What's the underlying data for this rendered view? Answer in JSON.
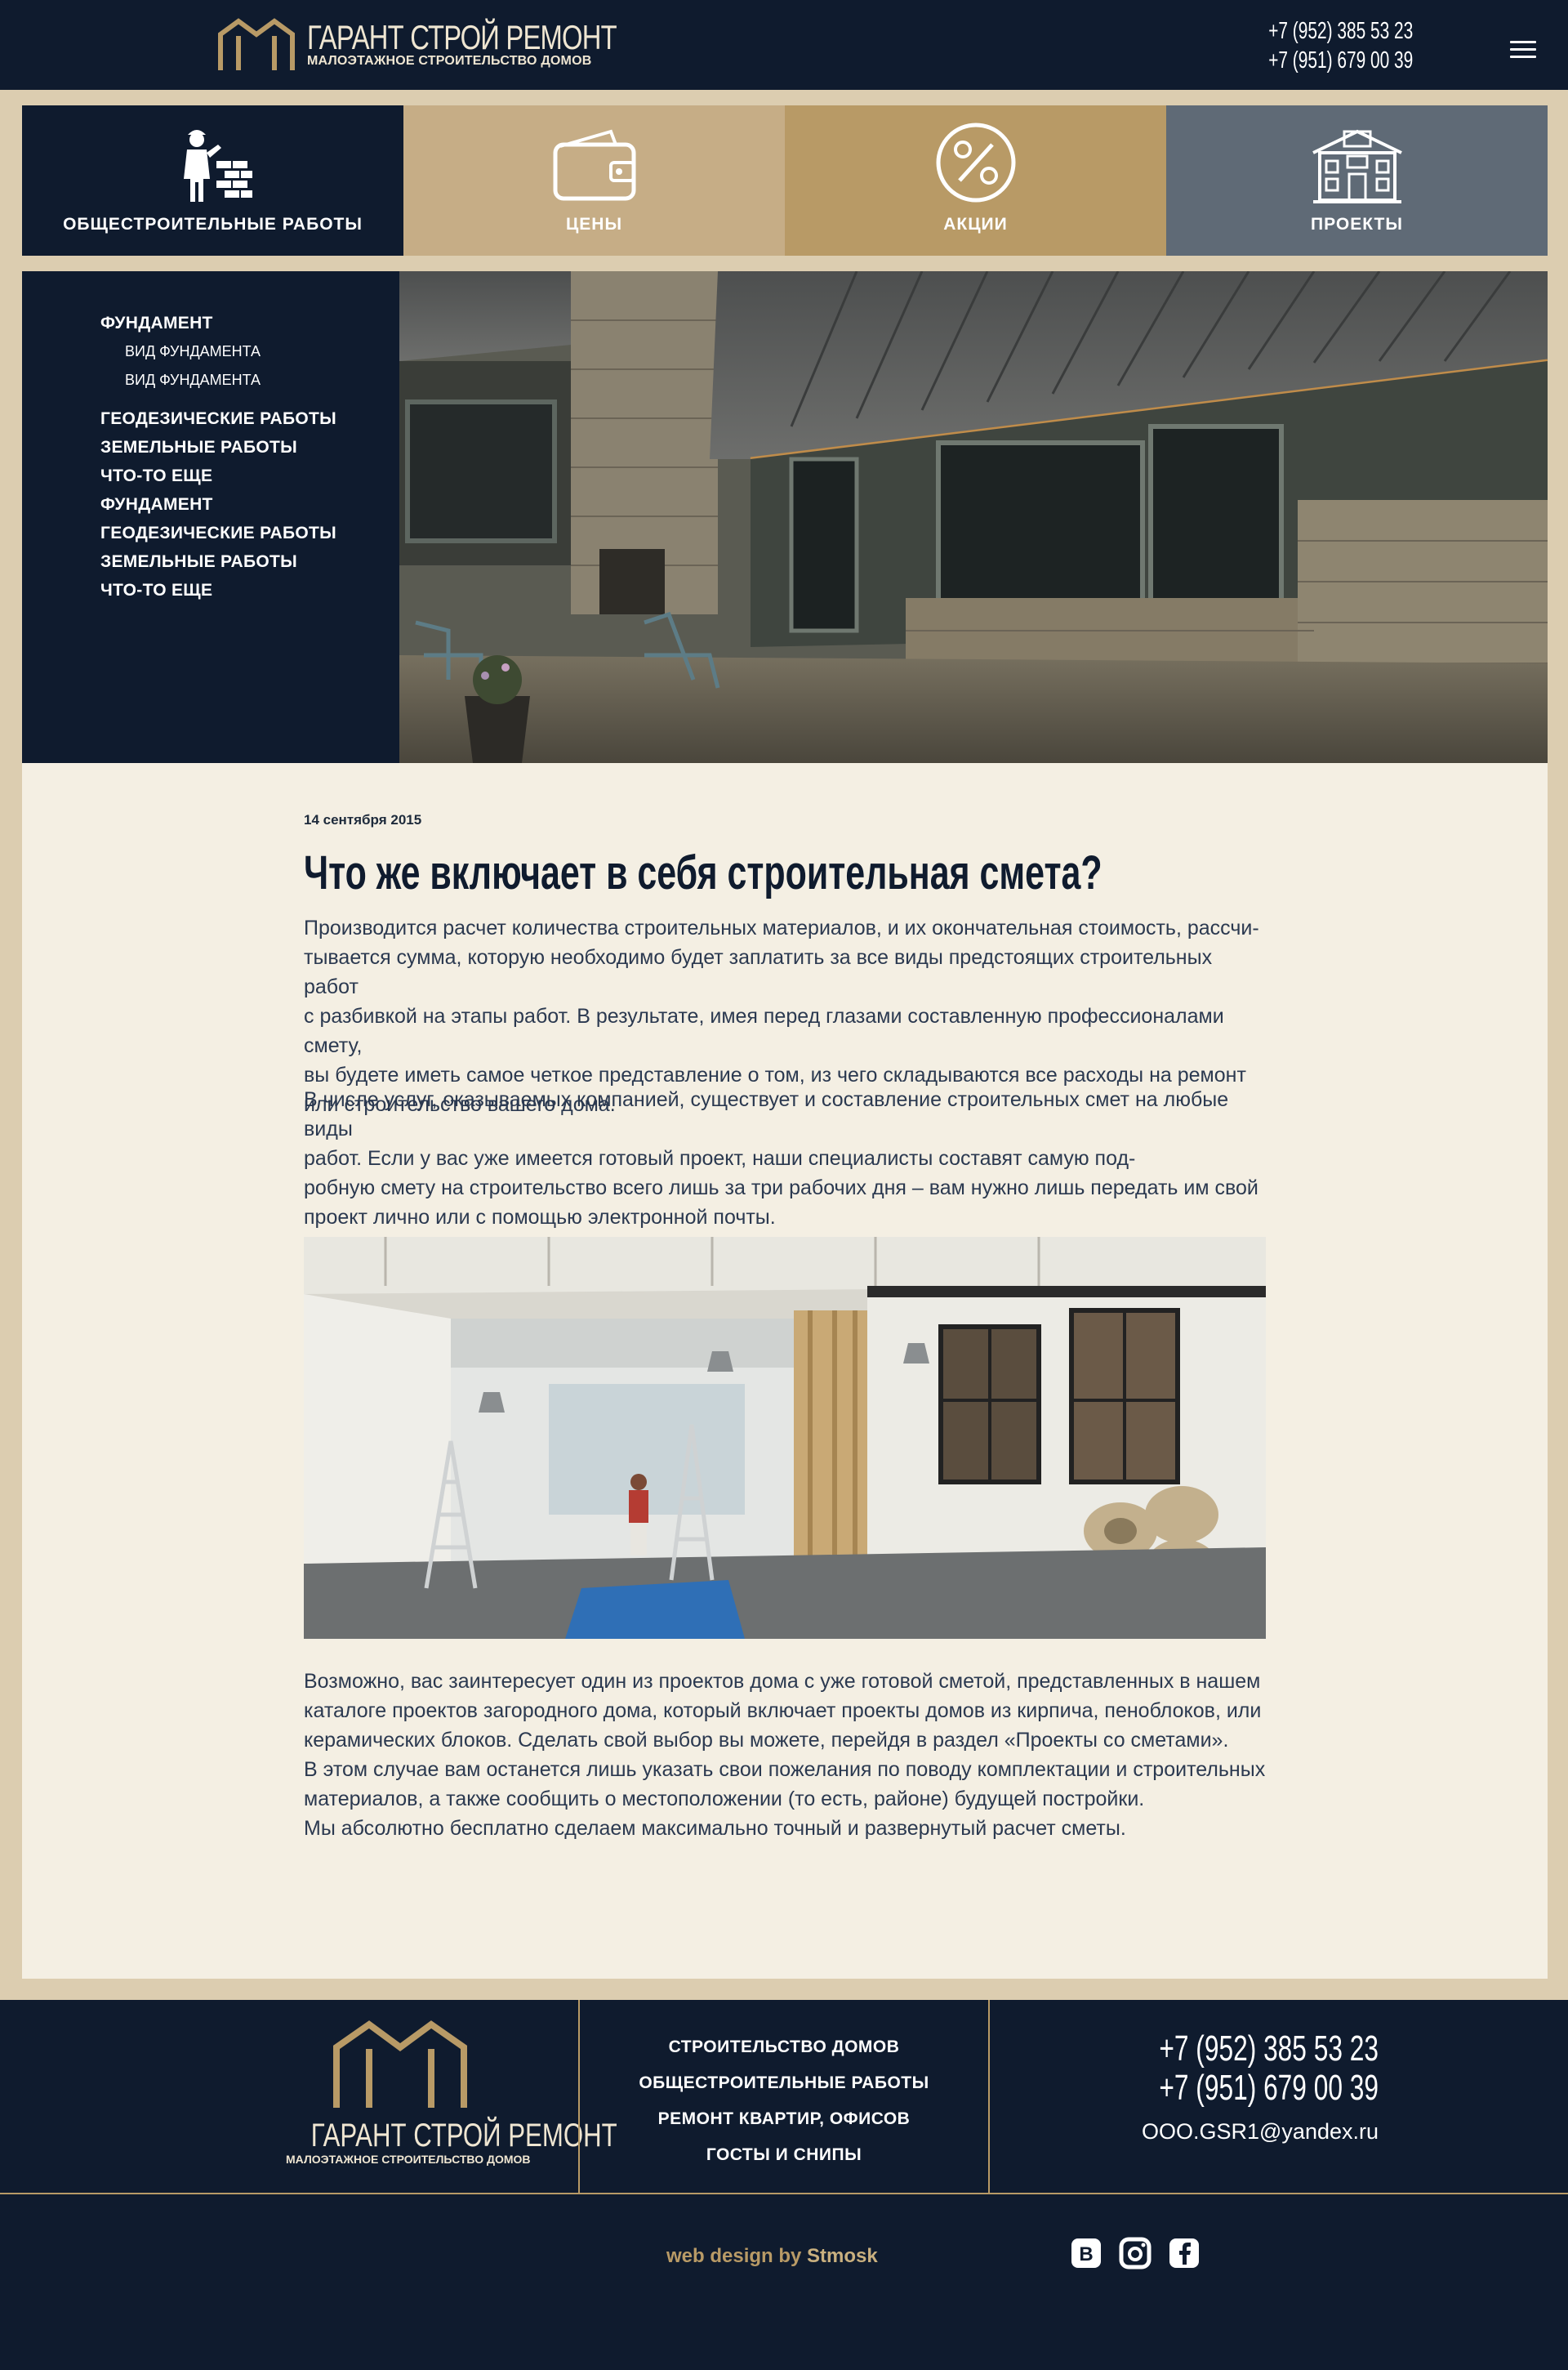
{
  "header": {
    "logo_title": "ГАРАНТ СТРОЙ РЕМОНТ",
    "logo_subtitle": "МАЛОЭТАЖНОЕ СТРОИТЕЛЬСТВО ДОМОВ",
    "phones": [
      "+7 (952) 385 53 23",
      "+7 (951) 679 00 39"
    ]
  },
  "tiles": [
    {
      "label": "ОБЩЕСТРОИТЕЛЬНЫЕ РАБОТЫ",
      "icon": "builder-icon",
      "color": "#0f1b2e"
    },
    {
      "label": "ЦЕНЫ",
      "icon": "wallet-icon",
      "color": "#c6ad86"
    },
    {
      "label": "АКЦИИ",
      "icon": "percent-icon",
      "color": "#b89a66"
    },
    {
      "label": "ПРОЕКТЫ",
      "icon": "house-icon",
      "color": "#5f6a76"
    }
  ],
  "side_menu": {
    "items": [
      {
        "label": "ФУНДАМЕНТ"
      },
      {
        "label": "ВИД ФУНДАМЕНТА"
      },
      {
        "label": "ВИД ФУНДАМЕНТА"
      },
      {
        "label": "ГЕОДЕЗИЧЕСКИЕ РАБОТЫ"
      },
      {
        "label": "ЗЕМЕЛЬНЫЕ РАБОТЫ"
      },
      {
        "label": "ЧТО-ТО ЕЩЕ"
      },
      {
        "label": "ФУНДАМЕНТ"
      },
      {
        "label": "ГЕОДЕЗИЧЕСКИЕ РАБОТЫ"
      },
      {
        "label": "ЗЕМЕЛЬНЫЕ РАБОТЫ"
      },
      {
        "label": "ЧТО-ТО ЕЩЕ"
      }
    ]
  },
  "article": {
    "date": "14 сентября 2015",
    "title": "Что же включает в себя строительная смета?",
    "paragraph_1": [
      "Производится расчет количества строительных материалов, и их окончательная стоимость, рассчи-",
      "тывается сумма, которую необходимо будет заплатить за все виды предстоящих строительных работ",
      "с разбивкой на этапы работ. В результате, имея перед глазами составленную профессионалами смету,",
      "вы будете иметь самое четкое представление о том, из чего складываются все расходы на ремонт",
      "или строительство вашего дома."
    ],
    "paragraph_2": [
      "В числе услуг, оказываемых компанией, существует и составление строительных смет на любые виды",
      "работ. Если у вас уже имеется готовый проект, наши специалисты составят самую под-",
      "робную смету на строительство всего лишь за три рабочих дня – вам нужно лишь передать им свой",
      "проект лично или с помощью электронной почты."
    ],
    "paragraph_3": [
      "Возможно, вас заинтересует один из проектов дома с уже готовой сметой, представленных в нашем",
      "каталоге проектов загородного дома, который включает проекты домов из кирпича, пеноблоков, или",
      "керамических блоков. Сделать свой выбор вы можете, перейдя в раздел «Проекты со сметами».",
      "В этом случае вам останется лишь указать свои пожелания по поводу комплектации и строительных",
      "материалов, а также сообщить о местоположении (то есть, районе) будущей постройки.",
      "Мы абсолютно бесплатно сделаем максимально точный и развернутый расчет сметы."
    ]
  },
  "footer": {
    "logo_title": "ГАРАНТ СТРОЙ РЕМОНТ",
    "logo_subtitle": "МАЛОЭТАЖНОЕ СТРОИТЕЛЬСТВО ДОМОВ",
    "menu": [
      "СТРОИТЕЛЬСТВО ДОМОВ",
      "ОБЩЕСТРОИТЕЛЬНЫЕ РАБОТЫ",
      "РЕМОНТ КВАРТИР, ОФИСОВ",
      "ГОСТЫ И СНИПЫ"
    ],
    "phones": [
      "+7 (952) 385 53 23",
      "+7 (951) 679 00 39"
    ],
    "email": "OOO.GSR1@yandex.ru",
    "credit_prefix": "web design by",
    "credit_name": "Stmosk",
    "social": [
      "vk-icon",
      "instagram-icon",
      "facebook-icon"
    ]
  },
  "colors": {
    "navy": "#0f1b2e",
    "gold": "#b89a66",
    "sand": "#c6ad86",
    "slate": "#5f6a76",
    "page_bg": "#dccdb0",
    "article_bg": "#f4efe3"
  }
}
